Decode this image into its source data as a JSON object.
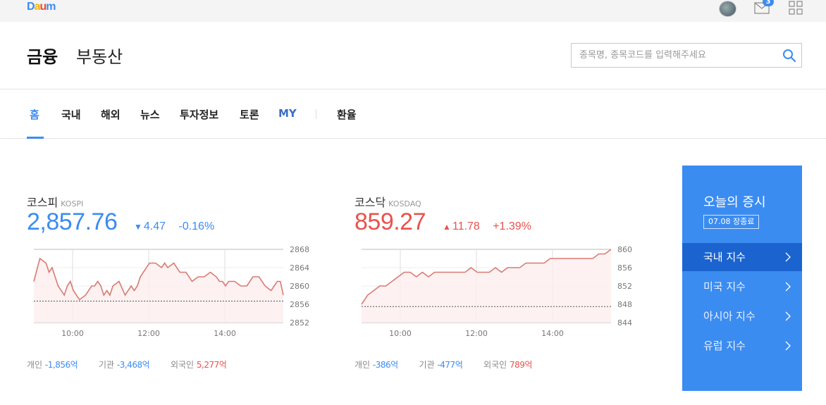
{
  "topbar": {
    "logo": "Daum",
    "logo_colors": [
      "#3b8cf1",
      "#f5b400",
      "#e84a35",
      "#3b8cf1",
      "#1aa85b"
    ],
    "mail_count": "3"
  },
  "header": {
    "brand_finance": "금융",
    "brand_realestate": "부동산",
    "search_placeholder": "종목명, 종목코드를 입력해주세요"
  },
  "nav": {
    "items": [
      "홈",
      "국내",
      "해외",
      "뉴스",
      "투자정보",
      "토론",
      "MY",
      "환율"
    ]
  },
  "markets": [
    {
      "name": "코스피",
      "sub": "KOSPI",
      "value": "2,857.76",
      "change": "4.47",
      "change_pct": "-0.16%",
      "direction": "down",
      "investors": [
        {
          "label": "개인",
          "value": "-1,856억",
          "tone": "blue"
        },
        {
          "label": "기관",
          "value": "-3,468억",
          "tone": "blue"
        },
        {
          "label": "외국인",
          "value": "5,277억",
          "tone": "red"
        }
      ]
    },
    {
      "name": "코스닥",
      "sub": "KOSDAQ",
      "value": "859.27",
      "change": "11.78",
      "change_pct": "+1.39%",
      "direction": "up",
      "investors": [
        {
          "label": "개인",
          "value": "-386억",
          "tone": "blue"
        },
        {
          "label": "기관",
          "value": "-477억",
          "tone": "blue"
        },
        {
          "label": "외국인",
          "value": "789억",
          "tone": "red"
        }
      ]
    }
  ],
  "chart_data": [
    {
      "type": "line",
      "series": [
        {
          "name": "코스피",
          "color": "#d97a73",
          "x": [
            0,
            10,
            20,
            25,
            30,
            40,
            50,
            55,
            60,
            65,
            75,
            85,
            95,
            100,
            105,
            110,
            115,
            120,
            125,
            130,
            140,
            150,
            160,
            165,
            170,
            175,
            180,
            190,
            200,
            210,
            215,
            220,
            230,
            240,
            250,
            260,
            270,
            280,
            290,
            300,
            305,
            310,
            315,
            320,
            330,
            340,
            350,
            355,
            360,
            370,
            380,
            390,
            400,
            405,
            410
          ],
          "y": [
            2861,
            2866,
            2865,
            2863,
            2864,
            2860,
            2858,
            2860,
            2861,
            2859,
            2857,
            2858,
            2860,
            2860,
            2861,
            2860,
            2858,
            2859,
            2858,
            2860,
            2861,
            2858,
            2860,
            2859,
            2860,
            2862,
            2863,
            2865,
            2865,
            2864,
            2865,
            2864,
            2865,
            2863,
            2863,
            2861,
            2862,
            2862,
            2863,
            2862,
            2861,
            2861,
            2860,
            2861,
            2861,
            2860,
            2860,
            2861,
            2862,
            2862,
            2860,
            2859,
            2861,
            2861,
            2858
          ]
        }
      ],
      "xticks": [
        "10:00",
        "12:00",
        "14:00"
      ],
      "yticks": [
        2868,
        2864,
        2860,
        2856,
        2852
      ],
      "ylim": [
        2852,
        2868
      ],
      "baseline": 2856.7,
      "grid": true
    },
    {
      "type": "line",
      "series": [
        {
          "name": "코스닥",
          "color": "#d97a73",
          "x": [
            0,
            10,
            20,
            30,
            40,
            50,
            60,
            70,
            80,
            90,
            100,
            110,
            120,
            130,
            140,
            150,
            160,
            170,
            180,
            190,
            200,
            210,
            220,
            230,
            240,
            250,
            260,
            270,
            280,
            290,
            300,
            310,
            320,
            330,
            340,
            350,
            360,
            370,
            380,
            390,
            400,
            410
          ],
          "y": [
            848,
            850,
            851,
            852,
            852,
            853,
            854,
            855,
            855,
            854,
            855,
            854,
            855,
            855,
            855,
            855,
            855,
            855,
            856,
            855,
            855,
            855,
            856,
            855,
            856,
            856,
            856,
            857,
            857,
            857,
            857,
            858,
            858,
            858,
            858,
            858,
            858,
            858,
            858,
            859,
            859,
            860
          ]
        }
      ],
      "xticks": [
        "10:00",
        "12:00",
        "14:00"
      ],
      "yticks": [
        860,
        856,
        852,
        848,
        844
      ],
      "ylim": [
        844,
        860
      ],
      "baseline": 847.5,
      "grid": true
    }
  ],
  "side_panel": {
    "title": "오늘의 증시",
    "status": "07.08 장종료",
    "items": [
      "국내 지수",
      "미국 지수",
      "아시아 지수",
      "유럽 지수"
    ]
  }
}
